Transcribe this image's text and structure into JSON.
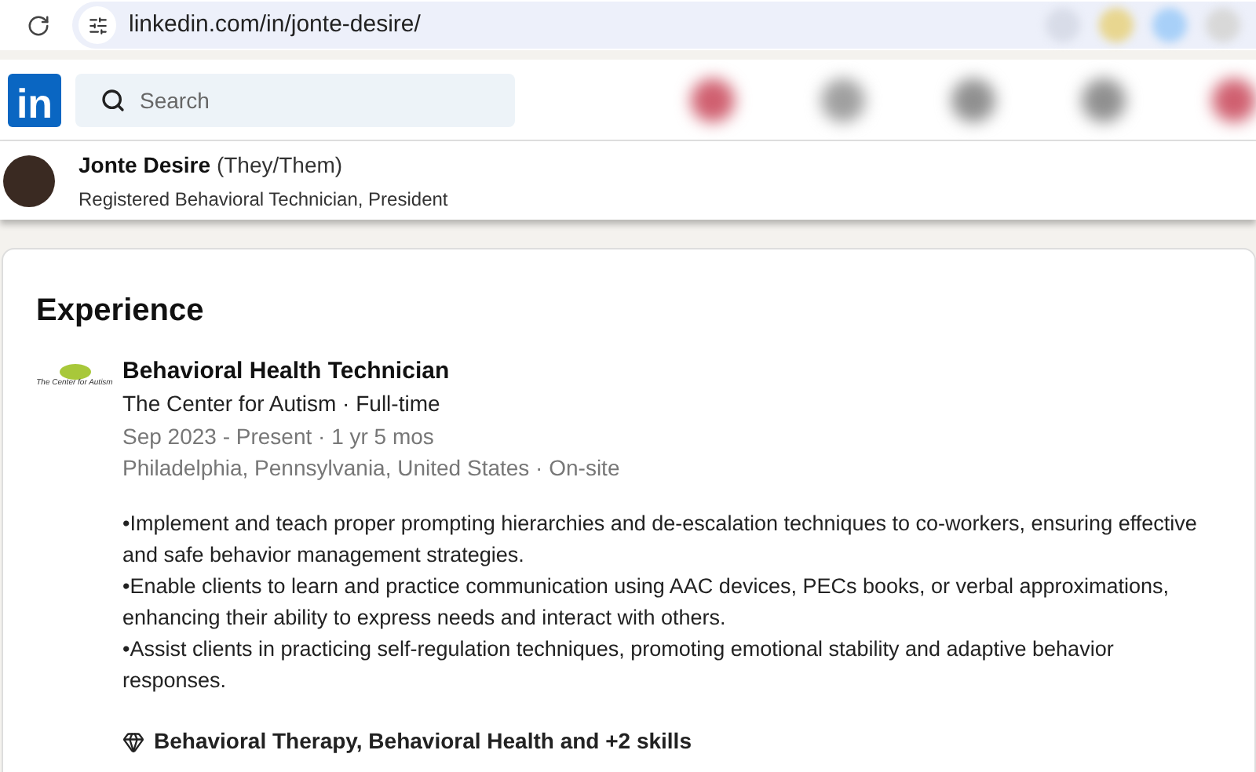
{
  "browser": {
    "url": "linkedin.com/in/jonte-desire/"
  },
  "header": {
    "logo": "in",
    "search": {
      "placeholder": "Search"
    }
  },
  "profile_bar": {
    "name": "Jonte Desire",
    "pronouns": "(They/Them)",
    "headline": "Registered Behavioral Technician, President"
  },
  "experience": {
    "title": "Experience",
    "items": [
      {
        "logo_text": "The Center for Autism",
        "role": "Behavioral Health Technician",
        "company": "The Center for Autism · Full-time",
        "dates": "Sep 2023 - Present · 1 yr 5 mos",
        "location": "Philadelphia, Pennsylvania, United States · On-site",
        "description": [
          "•Implement and teach proper prompting hierarchies and de-escalation techniques to co-workers, ensuring effective and safe behavior management strategies.",
          "•Enable clients to learn and practice communication using AAC devices, PECs books, or verbal approximations, enhancing their ability to express needs and interact with others.",
          "•Assist clients in practicing self-regulation techniques, promoting emotional stability and adaptive behavior responses."
        ],
        "skills": "Behavioral Therapy, Behavioral Health and +2 skills"
      }
    ]
  }
}
